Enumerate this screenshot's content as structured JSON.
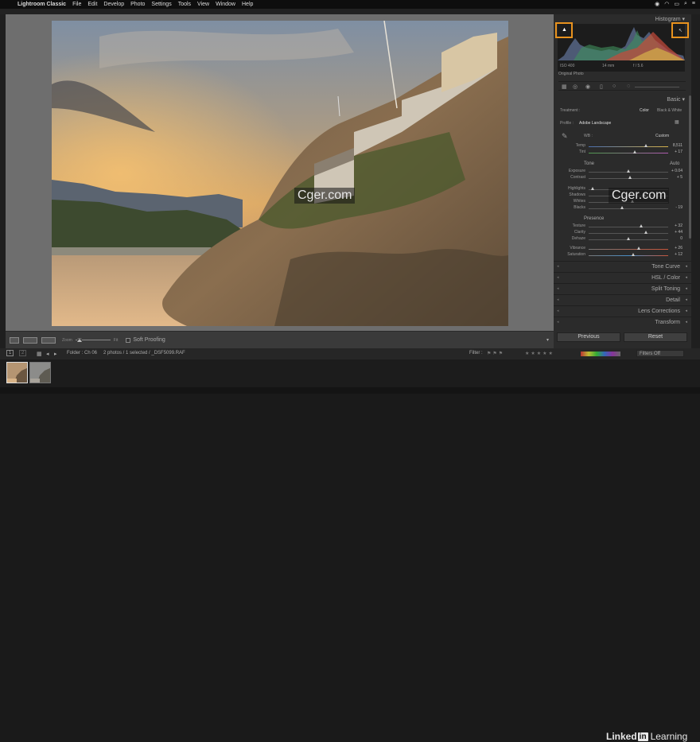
{
  "menubar": {
    "app_name": "Lightroom Classic",
    "items": [
      "File",
      "Edit",
      "Develop",
      "Photo",
      "Settings",
      "Tools",
      "View",
      "Window",
      "Help"
    ]
  },
  "toolbar": {
    "zoom_label": "Zoom",
    "zoom_fit": "Fit",
    "soft_proofing": "Soft Proofing"
  },
  "histogram": {
    "title": "Histogram",
    "iso": "ISO 400",
    "focal": "14 mm",
    "aperture": "f / 5.6",
    "original_photo": "Original Photo"
  },
  "basic": {
    "title": "Basic",
    "treatment_label": "Treatment :",
    "treatment_color": "Color",
    "treatment_bw": "Black & White",
    "profile_label": "Profile :",
    "profile_value": "Adobe Landscape",
    "wb_label": "WB :",
    "wb_value": "Custom",
    "tone_label": "Tone",
    "tone_auto": "Auto",
    "presence_label": "Presence",
    "sliders": [
      {
        "label": "Temp",
        "value": "8,511",
        "pos": 0.72
      },
      {
        "label": "Tint",
        "value": "+ 17",
        "pos": 0.58
      },
      {
        "label": "Exposure",
        "value": "+ 0.04",
        "pos": 0.5
      },
      {
        "label": "Contrast",
        "value": "+ 5",
        "pos": 0.52
      },
      {
        "label": "Highlights",
        "value": "",
        "pos": 0.05
      },
      {
        "label": "Shadows",
        "value": "",
        "pos": 0.7
      },
      {
        "label": "Whites",
        "value": "",
        "pos": 0.55
      },
      {
        "label": "Blacks",
        "value": "- 19",
        "pos": 0.42
      },
      {
        "label": "Texture",
        "value": "+ 32",
        "pos": 0.66
      },
      {
        "label": "Clarity",
        "value": "+ 44",
        "pos": 0.72
      },
      {
        "label": "Dehaze",
        "value": "0",
        "pos": 0.5
      },
      {
        "label": "Vibrance",
        "value": "+ 26",
        "pos": 0.63
      },
      {
        "label": "Saturation",
        "value": "+ 12",
        "pos": 0.56
      }
    ]
  },
  "panels": [
    "Tone Curve",
    "HSL / Color",
    "Split Toning",
    "Detail",
    "Lens Corrections",
    "Transform"
  ],
  "buttons": {
    "previous": "Previous",
    "reset": "Reset"
  },
  "filmbar": {
    "folder": "Folder : Ch 06",
    "selection": "2 photos / 1 selected / _DSF5099.RAF",
    "filter": "Filter :",
    "filters_off": "Filters Off",
    "page1": "1",
    "page2": "2"
  },
  "watermark": "Cger.com",
  "brand": {
    "linked": "Linked",
    "in": "in",
    "learning": "Learning"
  },
  "colors": {
    "highlight": "#e8921e",
    "panel": "#2b2b2b",
    "viewer_bg": "#6e6e6e"
  }
}
